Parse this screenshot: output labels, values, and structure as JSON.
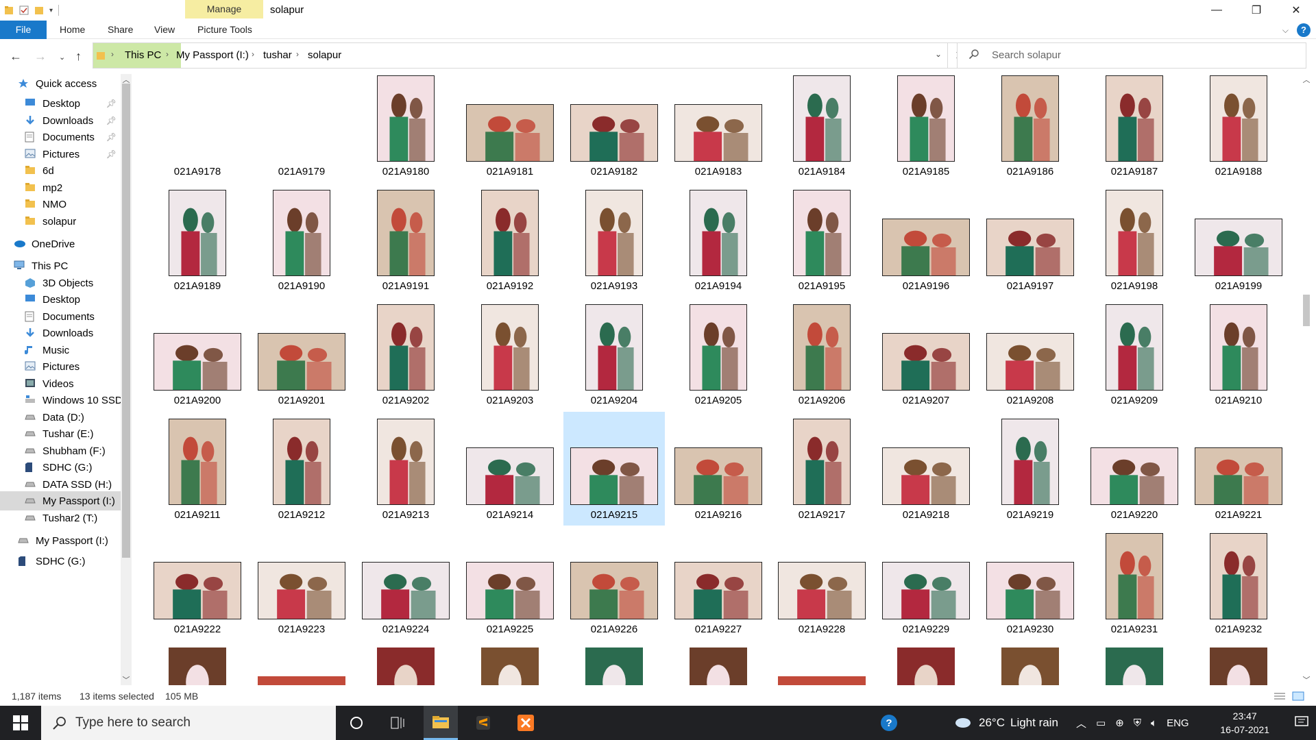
{
  "window": {
    "title": "solapur",
    "manage_tab": "Manage",
    "picture_tools_tab": "Picture Tools"
  },
  "ribbon": {
    "tabs": [
      "File",
      "Home",
      "Share",
      "View"
    ]
  },
  "address": {
    "crumbs": [
      "This PC",
      "My Passport (I:)",
      "tushar",
      "solapur"
    ]
  },
  "search": {
    "placeholder": "Search solapur"
  },
  "nav": {
    "items": [
      {
        "label": "Quick access",
        "icon": "star-icon",
        "pin": false
      },
      {
        "label": "Desktop",
        "icon": "desktop-icon",
        "pin": true
      },
      {
        "label": "Downloads",
        "icon": "download-icon",
        "pin": true
      },
      {
        "label": "Documents",
        "icon": "document-icon",
        "pin": true
      },
      {
        "label": "Pictures",
        "icon": "pictures-icon",
        "pin": true
      },
      {
        "label": "6d",
        "icon": "folder-icon",
        "pin": false
      },
      {
        "label": "mp2",
        "icon": "folder-icon",
        "pin": false
      },
      {
        "label": "NMO",
        "icon": "folder-icon",
        "pin": false
      },
      {
        "label": "solapur",
        "icon": "folder-icon",
        "pin": false
      },
      {
        "label": "OneDrive",
        "icon": "cloud-icon",
        "pin": false
      },
      {
        "label": "This PC",
        "icon": "computer-icon",
        "pin": false
      },
      {
        "label": "3D Objects",
        "icon": "cube-icon",
        "pin": false
      },
      {
        "label": "Desktop",
        "icon": "desktop-icon",
        "pin": false
      },
      {
        "label": "Documents",
        "icon": "document-icon",
        "pin": false
      },
      {
        "label": "Downloads",
        "icon": "download-icon",
        "pin": false
      },
      {
        "label": "Music",
        "icon": "music-icon",
        "pin": false
      },
      {
        "label": "Pictures",
        "icon": "pictures-icon",
        "pin": false
      },
      {
        "label": "Videos",
        "icon": "video-icon",
        "pin": false
      },
      {
        "label": "Windows 10 SSD",
        "icon": "windows-drive-icon",
        "pin": false
      },
      {
        "label": "Data (D:)",
        "icon": "drive-icon",
        "pin": false
      },
      {
        "label": "Tushar (E:)",
        "icon": "drive-icon",
        "pin": false
      },
      {
        "label": "Shubham (F:)",
        "icon": "drive-icon",
        "pin": false
      },
      {
        "label": "SDHC (G:)",
        "icon": "sd-card-icon",
        "pin": false
      },
      {
        "label": "DATA SSD (H:)",
        "icon": "drive-icon",
        "pin": false
      },
      {
        "label": "My Passport (I:)",
        "icon": "drive-icon",
        "pin": false,
        "selected": true
      },
      {
        "label": "Tushar2 (T:)",
        "icon": "drive-icon",
        "pin": false
      },
      {
        "label": "My Passport (I:)",
        "icon": "drive-icon",
        "pin": false
      },
      {
        "label": "SDHC (G:)",
        "icon": "sd-card-icon",
        "pin": false
      }
    ]
  },
  "files": [
    "021A9178",
    "021A9179",
    "021A9180",
    "021A9181",
    "021A9182",
    "021A9183",
    "021A9184",
    "021A9185",
    "021A9186",
    "021A9187",
    "021A9188",
    "021A9189",
    "021A9190",
    "021A9191",
    "021A9192",
    "021A9193",
    "021A9194",
    "021A9195",
    "021A9196",
    "021A9197",
    "021A9198",
    "021A9199",
    "021A9200",
    "021A9201",
    "021A9202",
    "021A9203",
    "021A9204",
    "021A9205",
    "021A9206",
    "021A9207",
    "021A9208",
    "021A9209",
    "021A9210",
    "021A9211",
    "021A9212",
    "021A9213",
    "021A9214",
    "021A9215",
    "021A9216",
    "021A9217",
    "021A9218",
    "021A9219",
    "021A9220",
    "021A9221",
    "021A9222",
    "021A9223",
    "021A9224",
    "021A9225",
    "021A9226",
    "021A9227",
    "021A9228",
    "021A9229",
    "021A9230",
    "021A9231",
    "021A9232"
  ],
  "selected_file": "021A9215",
  "status": {
    "count": "1,187 items",
    "selected": "13 items selected",
    "size": "105 MB"
  },
  "taskbar": {
    "search_placeholder": "Type here to search",
    "weather_temp": "26°C",
    "weather_text": "Light rain",
    "lang": "ENG",
    "time": "23:47",
    "date": "16-07-2021"
  },
  "colors": {
    "accent": "#1979ca",
    "manage": "#f6eda2",
    "selection": "#cce8ff",
    "address_highlight": "#cde8a6",
    "taskbar": "#202124"
  }
}
